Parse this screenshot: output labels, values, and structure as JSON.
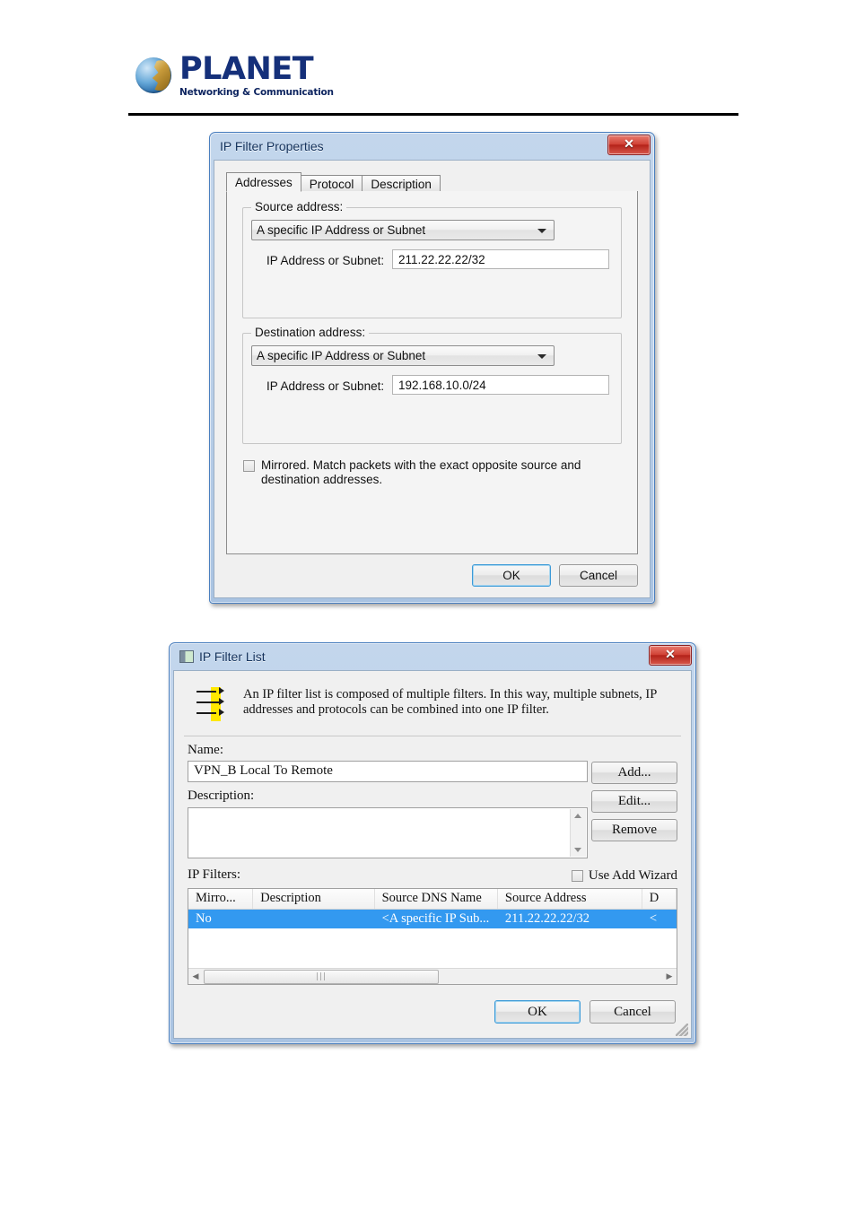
{
  "page": {
    "brand_name": "PLANET",
    "brand_tagline": "Networking & Communication"
  },
  "dialog1": {
    "title": "IP Filter Properties",
    "close_label": "✕",
    "tabs": [
      {
        "label": "Addresses",
        "selected": true
      },
      {
        "label": "Protocol",
        "selected": false
      },
      {
        "label": "Description",
        "selected": false
      }
    ],
    "source_group": {
      "title": "Source address:",
      "combo_value": "A specific IP Address or Subnet",
      "field_label": "IP Address or Subnet:",
      "field_value": "211.22.22.22/32"
    },
    "destination_group": {
      "title": "Destination address:",
      "combo_value": "A specific IP Address or Subnet",
      "field_label": "IP Address or Subnet:",
      "field_value": "192.168.10.0/24"
    },
    "mirrored": {
      "checked": false,
      "label": "Mirrored. Match packets with the exact opposite source and destination addresses."
    },
    "buttons": {
      "ok": "OK",
      "cancel": "Cancel"
    }
  },
  "dialog2": {
    "title": "IP Filter List",
    "close_label": "✕",
    "info_text": "An IP filter list is composed of multiple filters. In this way, multiple subnets, IP addresses and protocols can be combined into one IP filter.",
    "name_label": "Name:",
    "name_value": "VPN_B Local To Remote",
    "description_label": "Description:",
    "description_value": "",
    "side_buttons": {
      "add": "Add...",
      "edit": "Edit...",
      "remove": "Remove"
    },
    "filters_label": "IP Filters:",
    "use_add_wizard": {
      "checked": false,
      "label": "Use Add Wizard"
    },
    "table": {
      "columns": [
        "Mirro...",
        "Description",
        "Source DNS Name",
        "Source Address",
        "D"
      ],
      "rows": [
        {
          "cells": [
            "No",
            "",
            "<A specific IP Sub...",
            "211.22.22.22/32",
            "<"
          ],
          "selected": true
        }
      ]
    },
    "buttons": {
      "ok": "OK",
      "cancel": "Cancel"
    }
  },
  "colors": {
    "selection": "#3399f0",
    "title_text": "#14325c",
    "close_red": "#c0392b",
    "brand_blue": "#15307a",
    "icon_highlight": "#ffe800"
  }
}
